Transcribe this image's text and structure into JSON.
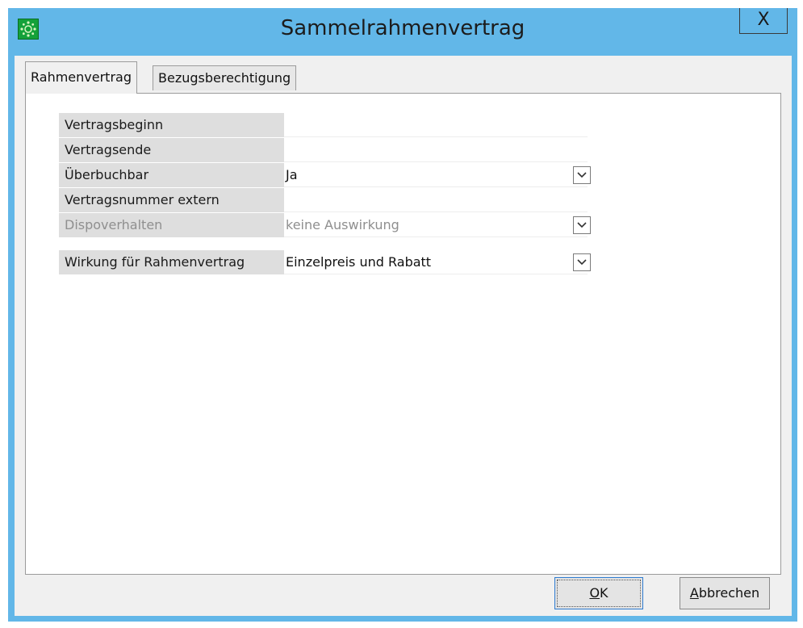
{
  "window": {
    "title": "Sammelrahmenvertrag",
    "close_label": "X"
  },
  "tabs": [
    {
      "label": "Rahmenvertrag",
      "active": true
    },
    {
      "label": "Bezugsberechtigung",
      "active": false
    }
  ],
  "form": {
    "rows": [
      {
        "label": "Vertragsbeginn",
        "value": ""
      },
      {
        "label": "Vertragsende",
        "value": ""
      },
      {
        "label": "Überbuchbar",
        "value": "Ja",
        "dropdown": true
      },
      {
        "label": "Vertragsnummer extern",
        "value": ""
      },
      {
        "label": "Dispoverhalten",
        "value": "keine Auswirkung",
        "dropdown": true,
        "disabled": true
      }
    ],
    "effect_row": {
      "label": "Wirkung für Rahmenvertrag",
      "value": "Einzelpreis und Rabatt",
      "dropdown": true
    }
  },
  "buttons": {
    "ok": {
      "mnemonic": "O",
      "rest": "K"
    },
    "cancel": {
      "mnemonic": "A",
      "rest": "bbrechen"
    }
  },
  "icons": {
    "app": "app-icon",
    "dropdown": "chevron-down-icon"
  },
  "colors": {
    "title_bar": "#62b7e8",
    "label_background": "#dedede",
    "app_icon": "#14a13a"
  }
}
